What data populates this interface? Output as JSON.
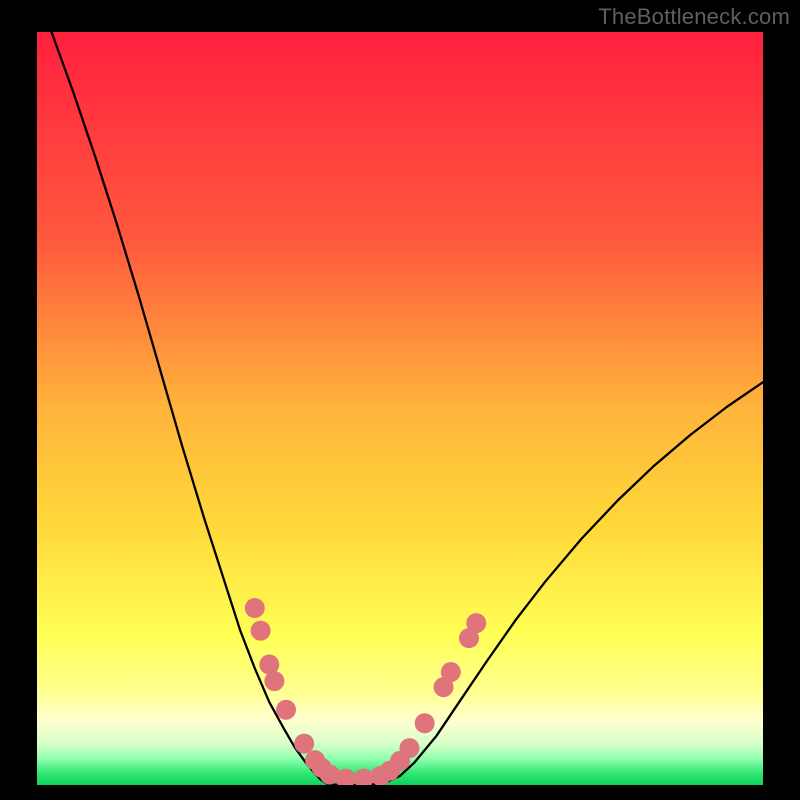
{
  "watermark": "TheBottleneck.com",
  "chart_data": {
    "type": "line",
    "title": "",
    "xlabel": "",
    "ylabel": "",
    "xlim": [
      0,
      100
    ],
    "ylim": [
      0,
      100
    ],
    "grid": false,
    "legend": false,
    "background_gradient": {
      "top": "#ff203e",
      "mid_upper": "#ff7c3c",
      "mid": "#ffd93a",
      "mid_lower": "#ffff8f",
      "lower_cream": "#ffffcf",
      "pale_green": "#d8ffc8",
      "green": "#2fe66e",
      "bottom": "#0fd060"
    },
    "series": [
      {
        "name": "left-curve",
        "stroke": "#000000",
        "x": [
          2,
          5,
          8,
          11,
          14,
          17,
          20,
          23,
          26,
          28,
          30,
          32,
          34,
          35.5,
          37,
          38.2,
          39.1,
          40
        ],
        "y": [
          100,
          92,
          83.5,
          74.5,
          65,
          55,
          45,
          35.5,
          26.5,
          20.5,
          15.5,
          11,
          7.5,
          5,
          3,
          1.6,
          0.7,
          0.15
        ]
      },
      {
        "name": "floor-curve",
        "stroke": "#000000",
        "x": [
          40,
          41,
          42,
          43,
          44,
          45,
          46,
          47,
          48
        ],
        "y": [
          0.15,
          0.05,
          0.02,
          0.0,
          0.02,
          0.05,
          0.1,
          0.2,
          0.35
        ]
      },
      {
        "name": "right-curve",
        "stroke": "#000000",
        "x": [
          48,
          50,
          52,
          55,
          58,
          62,
          66,
          70,
          75,
          80,
          85,
          90,
          95,
          100
        ],
        "y": [
          0.35,
          1.2,
          3,
          6.5,
          10.8,
          16.5,
          22,
          27,
          32.7,
          37.8,
          42.4,
          46.5,
          50.2,
          53.5
        ]
      }
    ],
    "markers": {
      "color": "#e0747c",
      "radius_px": 10,
      "points": [
        {
          "x": 30.0,
          "y": 23.5
        },
        {
          "x": 30.8,
          "y": 20.5
        },
        {
          "x": 32.0,
          "y": 16.0
        },
        {
          "x": 32.7,
          "y": 13.8
        },
        {
          "x": 34.3,
          "y": 10.0
        },
        {
          "x": 36.8,
          "y": 5.5
        },
        {
          "x": 38.3,
          "y": 3.3
        },
        {
          "x": 39.2,
          "y": 2.3
        },
        {
          "x": 40.3,
          "y": 1.4
        },
        {
          "x": 42.5,
          "y": 0.85
        },
        {
          "x": 45.0,
          "y": 0.85
        },
        {
          "x": 47.3,
          "y": 1.2
        },
        {
          "x": 48.6,
          "y": 1.9
        },
        {
          "x": 50.0,
          "y": 3.2
        },
        {
          "x": 51.3,
          "y": 4.9
        },
        {
          "x": 53.4,
          "y": 8.2
        },
        {
          "x": 56.0,
          "y": 13.0
        },
        {
          "x": 57.0,
          "y": 15.0
        },
        {
          "x": 59.5,
          "y": 19.5
        },
        {
          "x": 60.5,
          "y": 21.5
        }
      ]
    }
  }
}
